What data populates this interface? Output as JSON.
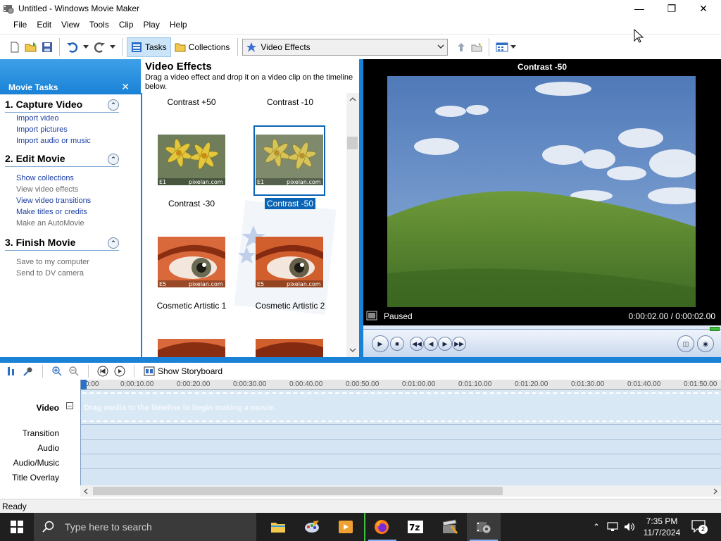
{
  "window": {
    "title": "Untitled - Windows Movie Maker"
  },
  "menu": [
    "File",
    "Edit",
    "View",
    "Tools",
    "Clip",
    "Play",
    "Help"
  ],
  "toolbar": {
    "tasks_label": "Tasks",
    "collections_label": "Collections",
    "collection_select": "Video Effects"
  },
  "tasks_pane": {
    "header": "Movie Tasks",
    "sections": [
      {
        "title": "1. Capture Video",
        "links": [
          {
            "label": "Import video",
            "enabled": true
          },
          {
            "label": "Import pictures",
            "enabled": true
          },
          {
            "label": "Import audio or music",
            "enabled": true
          }
        ]
      },
      {
        "title": "2. Edit Movie",
        "links": [
          {
            "label": "Show collections",
            "enabled": true
          },
          {
            "label": "View video effects",
            "enabled": false
          },
          {
            "label": "View video transitions",
            "enabled": true
          },
          {
            "label": "Make titles or credits",
            "enabled": true
          },
          {
            "label": "Make an AutoMovie",
            "enabled": false
          }
        ]
      },
      {
        "title": "3. Finish Movie",
        "links": [
          {
            "label": "Save to my computer",
            "enabled": false
          },
          {
            "label": "Send to DV camera",
            "enabled": false
          }
        ]
      }
    ]
  },
  "effects_pane": {
    "title": "Video Effects",
    "subtitle": "Drag a video effect and drop it on a video clip on the timeline below.",
    "items": [
      {
        "label": "Contrast +50",
        "selected": false
      },
      {
        "label": "Contrast -10",
        "selected": false
      },
      {
        "label": "Contrast -30",
        "selected": false,
        "badge": "E1",
        "watermark": "pixelan.com"
      },
      {
        "label": "Contrast -50",
        "selected": true,
        "badge": "E1",
        "watermark": "pixelan.com"
      },
      {
        "label": "Cosmetic Artistic 1",
        "selected": false,
        "badge": "E5",
        "watermark": "pixelan.com"
      },
      {
        "label": "Cosmetic Artistic 2",
        "selected": false,
        "badge": "E5",
        "watermark": "pixelan.com"
      }
    ]
  },
  "monitor": {
    "title": "Contrast -50",
    "status": "Paused",
    "time": "0:00:02.00 / 0:00:02.00"
  },
  "timeline": {
    "storyboard_label": "Show Storyboard",
    "tracks": {
      "video": "Video",
      "transition": "Transition",
      "audio": "Audio",
      "audio_music": "Audio/Music",
      "title_overlay": "Title Overlay"
    },
    "drop_hint": "Drag media to the timeline to begin making a movie.",
    "ruler_ticks": [
      "0:00",
      "0:00:10.00",
      "0:00:20.00",
      "0:00:30.00",
      "0:00:40.00",
      "0:00:50.00",
      "0:01:00.00",
      "0:01:10.00",
      "0:01:20.00",
      "0:01:30.00",
      "0:01:40.00",
      "0:01:50.00"
    ]
  },
  "statusbar": {
    "text": "Ready"
  },
  "taskbar": {
    "search_placeholder": "Type here to search",
    "time": "7:35 PM",
    "date": "11/7/2024",
    "notification_count": "2"
  },
  "colors": {
    "accent_blue": "#1a82d6",
    "selection_blue": "#0a64b5",
    "timeline_bg": "#d5e5f3"
  }
}
